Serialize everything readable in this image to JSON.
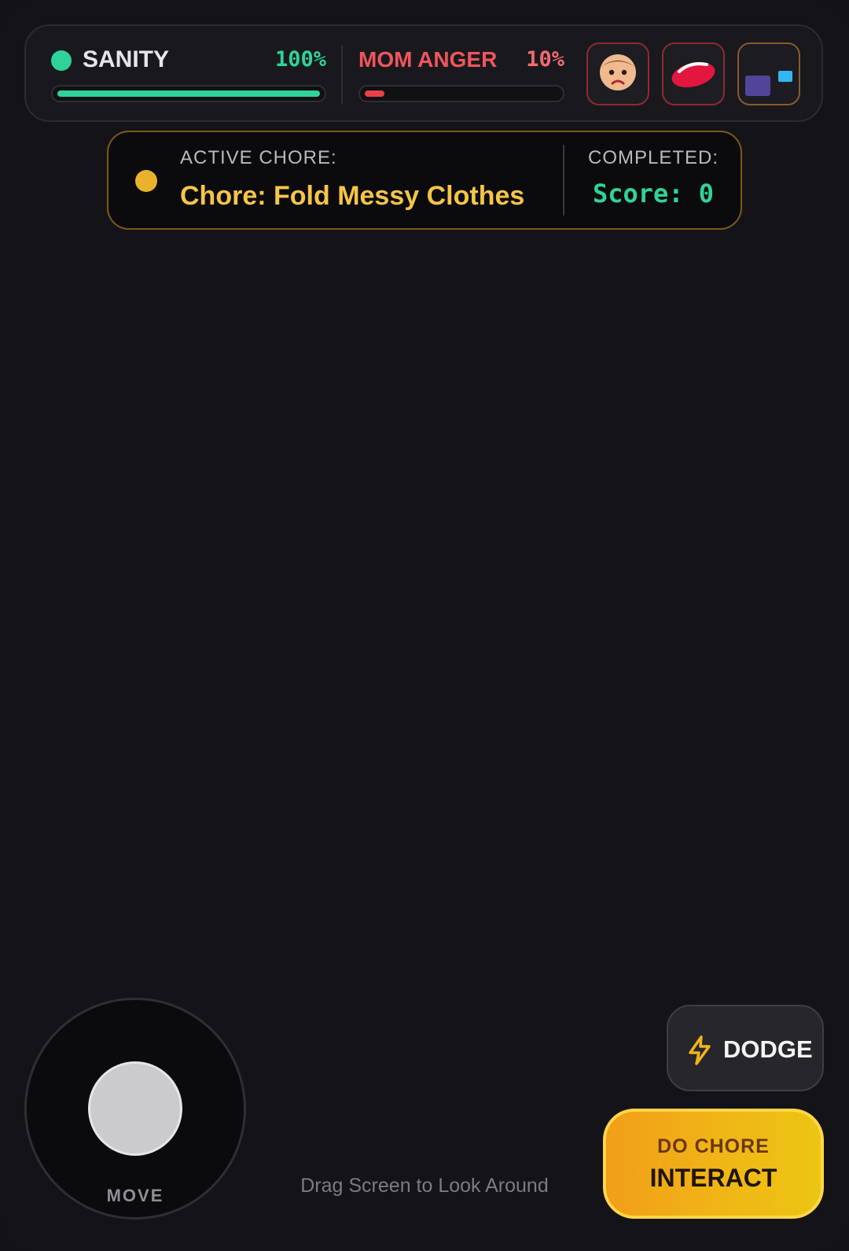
{
  "hud": {
    "sanity": {
      "label": "SANITY",
      "percent_text": "100%",
      "value": 1.0,
      "color": "#2fd39a"
    },
    "anger": {
      "label": "MOM ANGER",
      "percent_text": "10%",
      "value": 0.1,
      "color": "#e8414a"
    },
    "icons": [
      "mom-face-icon",
      "lips-icon",
      "rooms-map-icon"
    ]
  },
  "chore": {
    "label": "ACTIVE CHORE:",
    "name": "Chore: Fold Messy Clothes",
    "completed_label": "COMPLETED:",
    "score": "Score: 0",
    "accent_color": "#f6c547"
  },
  "controls": {
    "move_label": "MOVE",
    "look_hint": "Drag Screen to Look Around",
    "dodge_label": "DODGE",
    "interact_top": "DO CHORE",
    "interact_main": "INTERACT"
  }
}
